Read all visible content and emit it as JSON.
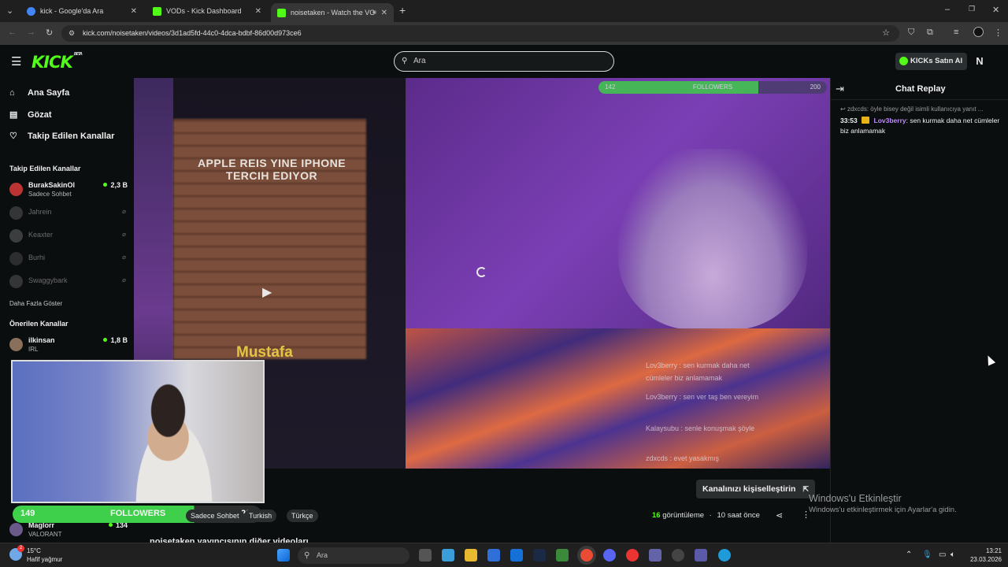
{
  "browser": {
    "tabs": [
      {
        "label": "kick - Google'da Ara",
        "favicon_color": "#4285f4"
      },
      {
        "label": "VODs - Kick Dashboard",
        "favicon_color": "#53fc18"
      },
      {
        "label": "noisetaken - Watch the VO",
        "favicon_color": "#53fc18"
      }
    ],
    "url": "kick.com/noisetaken/videos/3d1ad5fd-44c0-4dca-bdbf-86d00d973ce6"
  },
  "header": {
    "logo": "KICK",
    "logo_badge": "BETA",
    "search_placeholder": "Ara",
    "buy_kicks": "KICKs Satın Al",
    "user_initial": "N"
  },
  "sidebar": {
    "nav": [
      {
        "label": "Ana Sayfa",
        "icon": "home-icon"
      },
      {
        "label": "Gözat",
        "icon": "browse-icon"
      },
      {
        "label": "Takip Edilen Kanallar",
        "icon": "heart-icon"
      }
    ],
    "followed_heading": "Takip Edilen Kanallar",
    "followed": [
      {
        "name": "BurakSakinOl",
        "sub": "Sadece Sohbet",
        "viewers": "2,3 B",
        "live": true
      },
      {
        "name": "Jahrein",
        "live": false
      },
      {
        "name": "Keaxter",
        "live": false
      },
      {
        "name": "Burhi",
        "live": false
      },
      {
        "name": "Swaggybark",
        "live": false
      }
    ],
    "show_more": "Daha Fazla Göster",
    "suggested_heading": "Önerilen Kanallar",
    "suggested": [
      {
        "name": "ilkinsan",
        "sub": "IRL",
        "viewers": "1,8 B"
      },
      {
        "name": "Maglorr",
        "sub": "VALORANT",
        "viewers": "134"
      }
    ]
  },
  "video": {
    "brick_text": "APPLE REIS YINE IPHONE TERCIH EDIYOR",
    "name_caption": "Mustafa",
    "top_follow_label": "FOLLOWERS",
    "top_follow_left": "142",
    "top_follow_right": "200",
    "overlay_chat": [
      "Lov3berry : sen kurmak daha net",
      "cümleler biz anlamamak",
      "Lov3berry : sen ver taş ben vereyim",
      "Kalaysubu : senle konuşmak şöyle",
      "zdxcds : evet yasakmış"
    ]
  },
  "webcam": {
    "follow_current": "149",
    "follow_label": "FOLLOWERS",
    "follow_goal": "200"
  },
  "below_video": {
    "customize_button": "Kanalınızı kişiselleştirin",
    "tags": [
      "Sadece Sohbet",
      "Türkçe",
      "Turkish"
    ],
    "views_count": "16",
    "views_label": "görüntüleme",
    "time_ago": "10 saat önce",
    "more_videos_title": "noisetaken yayıncısının diğer videoları"
  },
  "chat": {
    "title": "Chat Replay",
    "reply_preview": "zdxcds: öyle bisey değil isimli kullanıcıya yanıt ...",
    "message": {
      "time": "33:53",
      "user": "Lov3berry",
      "text": "sen kurmak daha net cümleler biz anlamamak"
    }
  },
  "windows_activation": {
    "title": "Windows'u Etkinleştir",
    "subtitle": "Windows'u etkinleştirmek için Ayarlar'a gidin."
  },
  "taskbar": {
    "temperature": "15°C",
    "weather": "Hafif yağmur",
    "search_placeholder": "Ara",
    "time": "13:21",
    "date": "23.03.2026",
    "weather_badge": "2"
  }
}
